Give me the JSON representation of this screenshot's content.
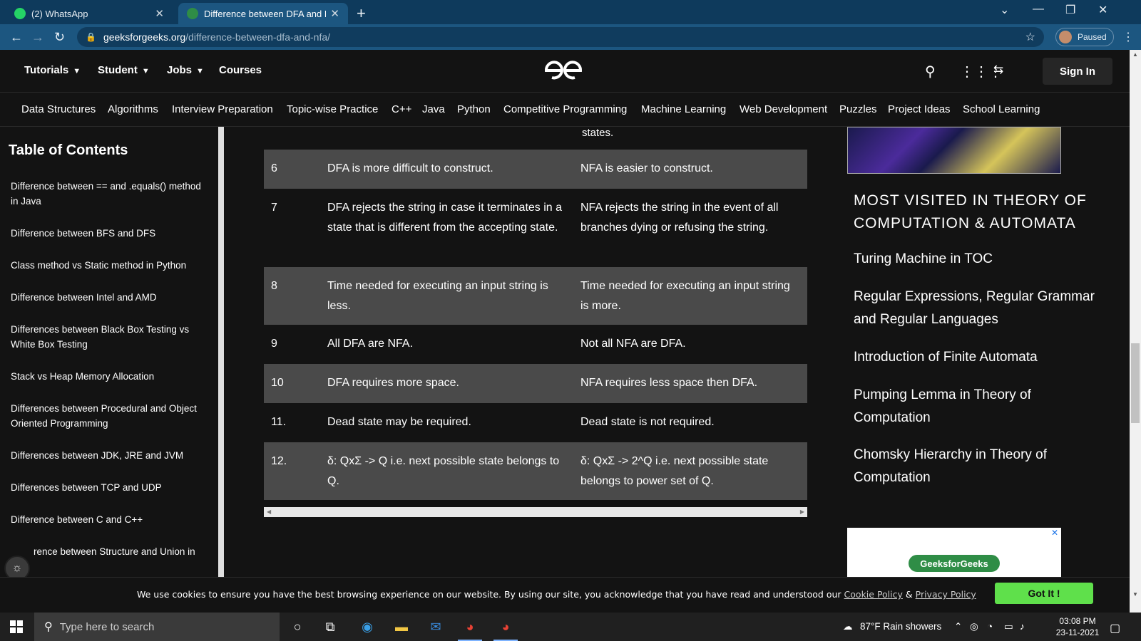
{
  "browser": {
    "tabs": [
      {
        "title": "(2) WhatsApp",
        "active": false
      },
      {
        "title": "Difference between DFA and NFA",
        "active": true
      }
    ],
    "url_host": "geeksforgeeks.org",
    "url_path": "/difference-between-dfa-and-nfa/",
    "profile_label": "Paused"
  },
  "header": {
    "nav": [
      "Tutorials",
      "Student",
      "Jobs",
      "Courses"
    ],
    "signin_label": "Sign In"
  },
  "subnav": [
    "Data Structures",
    "Algorithms",
    "Interview Preparation",
    "Topic-wise Practice",
    "C++",
    "Java",
    "Python",
    "Competitive Programming",
    "Machine Learning",
    "Web Development",
    "Puzzles",
    "Project Ideas",
    "School Learning"
  ],
  "toc": {
    "title": "Table of Contents",
    "items": [
      "Difference between == and .equals() method in Java",
      "Difference between BFS and DFS",
      "Class method vs Static method in Python",
      "Difference between Intel and AMD",
      "Differences between Black Box Testing vs White Box Testing",
      "Stack vs Heap Memory Allocation",
      "Differences between Procedural and Object Oriented Programming",
      "Differences between JDK, JRE and JVM",
      "Differences between TCP and UDP",
      "Difference between C and C++",
      "rence between Structure and Union in"
    ]
  },
  "article": {
    "states_tail": "states.",
    "rows": [
      {
        "num": "6",
        "dfa": "DFA is more difficult to construct.",
        "nfa": "NFA is easier to construct."
      },
      {
        "num": "7",
        "dfa": "DFA rejects the string in case it terminates in a state that is different from the accepting state.",
        "nfa": "NFA rejects the string in the event of all branches dying or refusing the string."
      },
      {
        "num": "8",
        "dfa": "Time needed for executing an input string is less.",
        "nfa": "Time needed for executing an input string is more."
      },
      {
        "num": "9",
        "dfa": "All DFA are NFA.",
        "nfa": "Not all NFA are DFA."
      },
      {
        "num": "10",
        "dfa": "DFA requires more space.",
        "nfa": "NFA requires less space then DFA."
      },
      {
        "num": "11.",
        "dfa": "Dead state may be required.",
        "nfa": "Dead state is not required."
      },
      {
        "num": "12.",
        "dfa": "δ: QxΣ -> Q i.e. next possible state belongs to Q.",
        "nfa": "δ: QxΣ -> 2^Q i.e. next possible state belongs to power set of Q."
      }
    ]
  },
  "sidebar": {
    "most_visited_title": "MOST VISITED IN THEORY OF COMPUTATION & AUTOMATA",
    "links": [
      "Turing Machine in TOC",
      "Regular Expressions, Regular Grammar and Regular Languages",
      "Introduction of Finite Automata",
      "Pumping Lemma in Theory of Computation",
      "Chomsky Hierarchy in Theory of Computation"
    ],
    "ad_button": "GeeksforGeeks"
  },
  "cookie": {
    "text": "We use cookies to ensure you have the best browsing experience on our website. By using our site, you acknowledge that you have read and understood our",
    "cookie_link": "Cookie Policy",
    "amp": "&",
    "privacy_link": "Privacy Policy",
    "button": "Got It !"
  },
  "taskbar": {
    "search_placeholder": "Type here to search",
    "weather": "87°F  Rain showers",
    "time": "03:08 PM",
    "date": "23-11-2021"
  },
  "colors": {
    "accent_green": "#2f8d46",
    "got_it": "#5fe04b",
    "row_shade": "#4a4a4a"
  }
}
